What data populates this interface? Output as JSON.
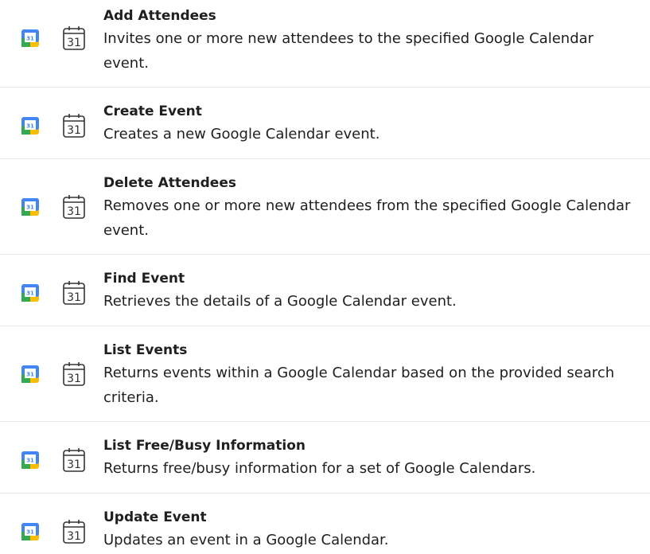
{
  "actions": [
    {
      "title": "Add Attendees",
      "description": "Invites one or more new attendees to the specified Google Calendar event.",
      "app_icon": "google-calendar-icon",
      "action_icon": "calendar-outline-icon"
    },
    {
      "title": "Create Event",
      "description": "Creates a new Google Calendar event.",
      "app_icon": "google-calendar-icon",
      "action_icon": "calendar-outline-icon"
    },
    {
      "title": "Delete Attendees",
      "description": "Removes one or more new attendees from the specified Google Calendar event.",
      "app_icon": "google-calendar-icon",
      "action_icon": "calendar-outline-icon"
    },
    {
      "title": "Find Event",
      "description": "Retrieves the details of a Google Calendar event.",
      "app_icon": "google-calendar-icon",
      "action_icon": "calendar-outline-icon"
    },
    {
      "title": "List Events",
      "description": "Returns events within a Google Calendar based on the provided search criteria.",
      "app_icon": "google-calendar-icon",
      "action_icon": "calendar-outline-icon"
    },
    {
      "title": "List Free/Busy Information",
      "description": "Returns free/busy information for a set of Google Calendars.",
      "app_icon": "google-calendar-icon",
      "action_icon": "calendar-outline-icon"
    },
    {
      "title": "Update Event",
      "description": "Updates an event in a Google Calendar.",
      "app_icon": "google-calendar-icon",
      "action_icon": "calendar-outline-icon"
    }
  ],
  "icon_text": {
    "day": "31"
  },
  "colors": {
    "google_blue": "#4285F4",
    "google_green": "#34A853",
    "google_yellow": "#FBBC04",
    "google_red": "#EA4335",
    "divider": "#e6e6e6",
    "text": "#1f1f1f"
  }
}
